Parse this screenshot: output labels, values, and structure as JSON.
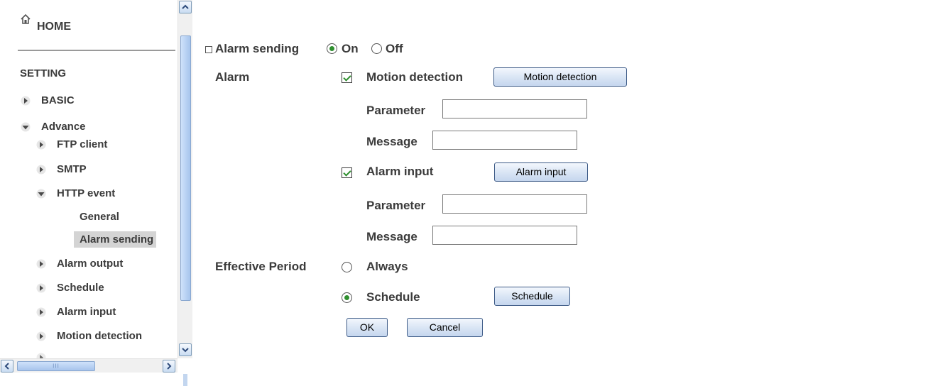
{
  "nav": {
    "home": "HOME",
    "setting": "SETTING",
    "basic": "BASIC",
    "advance": "Advance",
    "items": {
      "ftp_client": "FTP client",
      "smtp": "SMTP",
      "http_event": "HTTP event",
      "general": "General",
      "alarm_sending": "Alarm sending",
      "alarm_output": "Alarm output",
      "schedule": "Schedule",
      "alarm_input": "Alarm input",
      "motion_detection": "Motion detection"
    },
    "scrollbar_grip": "III"
  },
  "form": {
    "section_title": "Alarm sending",
    "on_label": "On",
    "off_label": "Off",
    "alarm_sending_value": "On",
    "alarm_label": "Alarm",
    "motion_detection": {
      "label": "Motion detection",
      "checked": true,
      "button": "Motion detection",
      "parameter_label": "Parameter",
      "parameter_value": "",
      "message_label": "Message",
      "message_value": ""
    },
    "alarm_input": {
      "label": "Alarm input",
      "checked": true,
      "button": "Alarm input",
      "parameter_label": "Parameter",
      "parameter_value": "",
      "message_label": "Message",
      "message_value": ""
    },
    "effective_period_label": "Effective Period",
    "always_label": "Always",
    "schedule_label": "Schedule",
    "effective_period_value": "Schedule",
    "schedule_button": "Schedule",
    "ok_button": "OK",
    "cancel_button": "Cancel"
  },
  "colors": {
    "accent_green": "#2f8f2f",
    "button_border": "#3c5a86",
    "selected_bg": "#d4d4d4"
  }
}
